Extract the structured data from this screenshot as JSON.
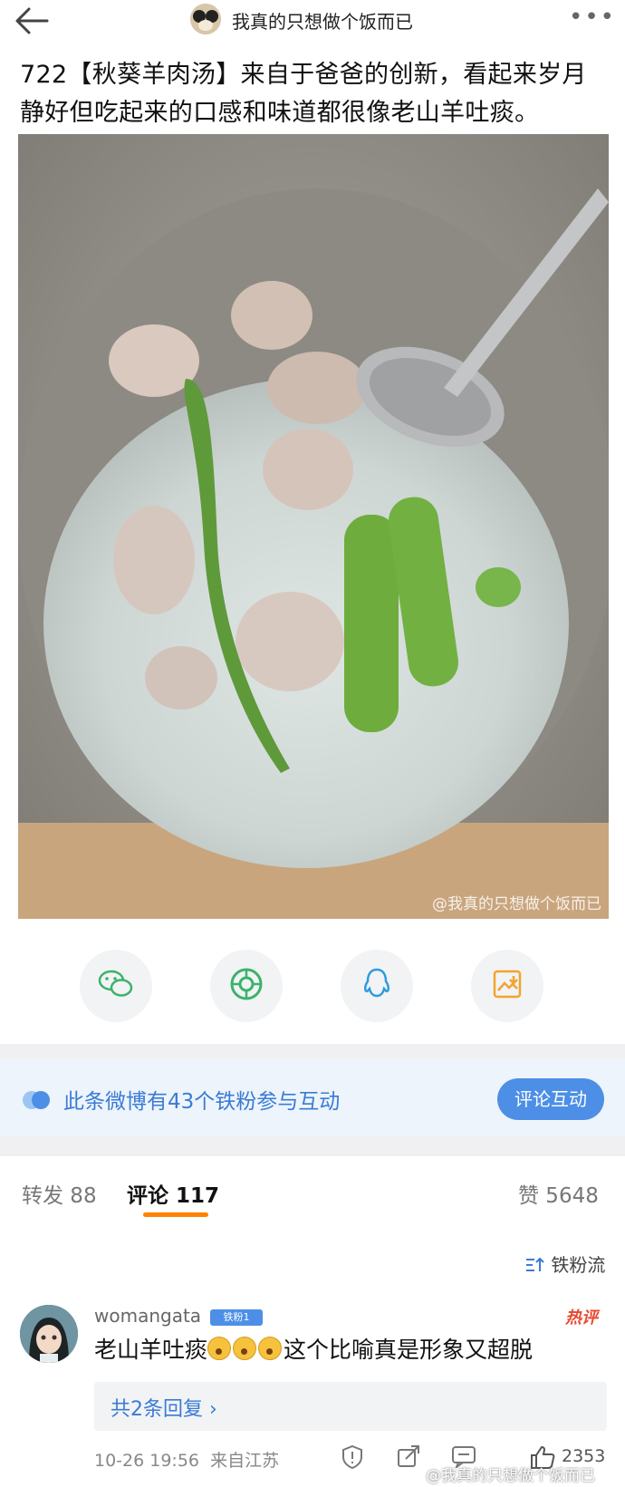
{
  "header": {
    "title": "我真的只想做个饭而已",
    "more_label": "•••"
  },
  "post": {
    "text": "722【秋葵羊肉汤】来自于爸爸的创新，看起来岁月静好但吃起来的口感和味道都很像老山羊吐痰。",
    "image_watermark": "@我真的只想做个饭而已"
  },
  "share_icons": [
    "wechat-icon",
    "moments-icon",
    "qq-icon",
    "save-image-icon"
  ],
  "iron_fans_banner": {
    "text": "此条微博有43个铁粉参与互动",
    "button_label": "评论互动"
  },
  "tabs": [
    {
      "label": "转发 88"
    },
    {
      "label": "评论 117"
    },
    {
      "label": "赞 5648"
    }
  ],
  "sort_label": "铁粉流",
  "comment": {
    "username": "womangata",
    "badge": "铁粉1",
    "hot_label": "热评",
    "text_before": "老山羊吐痰",
    "text_after": "这个比喻真是形象又超脱",
    "replies_label": "共2条回复 ›",
    "time": "10-26 19:56",
    "location": "来自江苏",
    "likes": "2353"
  },
  "bottom_watermark": "@我真的只想做个饭而已",
  "colors": {
    "accent_blue": "#4d8fe6",
    "tab_underline": "#ff8200",
    "hot_red": "#e84a2f"
  }
}
